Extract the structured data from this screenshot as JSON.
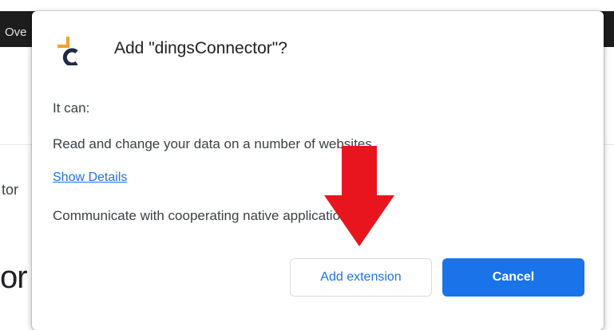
{
  "background": {
    "topbar_text": "Ove",
    "text_1": "tor",
    "text_2": "or"
  },
  "dialog": {
    "title": "Add \"dingsConnector\"?",
    "icon": "dings-connector-logo",
    "it_can": "It can:",
    "permissions": [
      "Read and change your data on a number of websites",
      "Communicate with cooperating native applications"
    ],
    "details_link": "Show Details",
    "add_button": "Add extension",
    "cancel_button": "Cancel"
  },
  "colors": {
    "accent": "#1a73e8",
    "arrow": "#e8141e",
    "logo_orange": "#f2a12e",
    "logo_navy": "#1f2a44"
  }
}
